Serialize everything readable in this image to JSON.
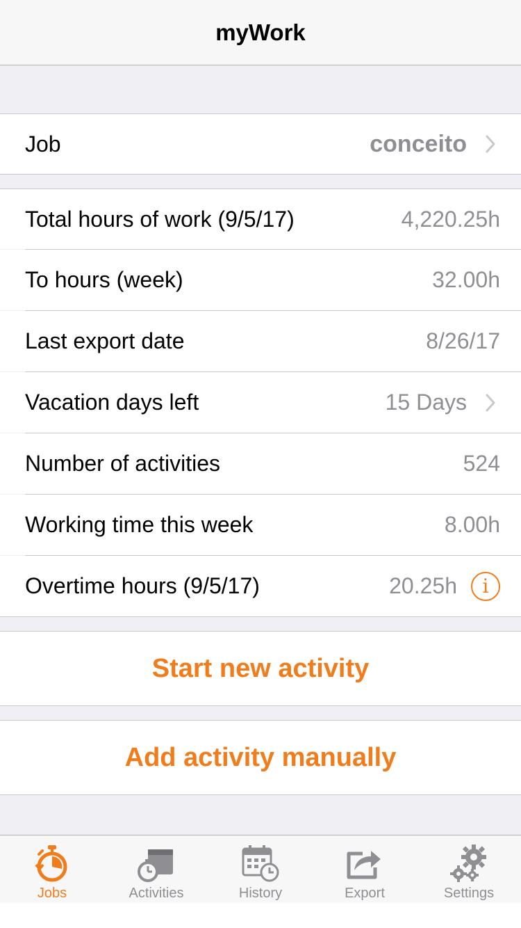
{
  "navbar": {
    "title": "myWork"
  },
  "job": {
    "label": "Job",
    "value": "conceito"
  },
  "stats": [
    {
      "label": "Total hours of work (9/5/17)",
      "value": "4,220.25h"
    },
    {
      "label": "To hours (week)",
      "value": "32.00h"
    },
    {
      "label": "Last export date",
      "value": "8/26/17"
    },
    {
      "label": "Vacation days left",
      "value": "15 Days"
    },
    {
      "label": "Number of activities",
      "value": "524"
    },
    {
      "label": "Working time this week",
      "value": "8.00h"
    },
    {
      "label": "Overtime hours (9/5/17)",
      "value": "20.25h"
    }
  ],
  "info_icon_glyph": "i",
  "actions": {
    "start": "Start new activity",
    "add": "Add activity manually"
  },
  "tabs": [
    {
      "label": "Jobs",
      "icon": "stopwatch-icon",
      "active": true
    },
    {
      "label": "Activities",
      "icon": "activities-icon",
      "active": false
    },
    {
      "label": "History",
      "icon": "calendar-clock-icon",
      "active": false
    },
    {
      "label": "Export",
      "icon": "export-icon",
      "active": false
    },
    {
      "label": "Settings",
      "icon": "gears-icon",
      "active": false
    }
  ],
  "colors": {
    "accent": "#f07c1b",
    "secondary_text": "#8e8e93",
    "background": "#efeff4",
    "inactive_icon": "#8e8e93"
  }
}
